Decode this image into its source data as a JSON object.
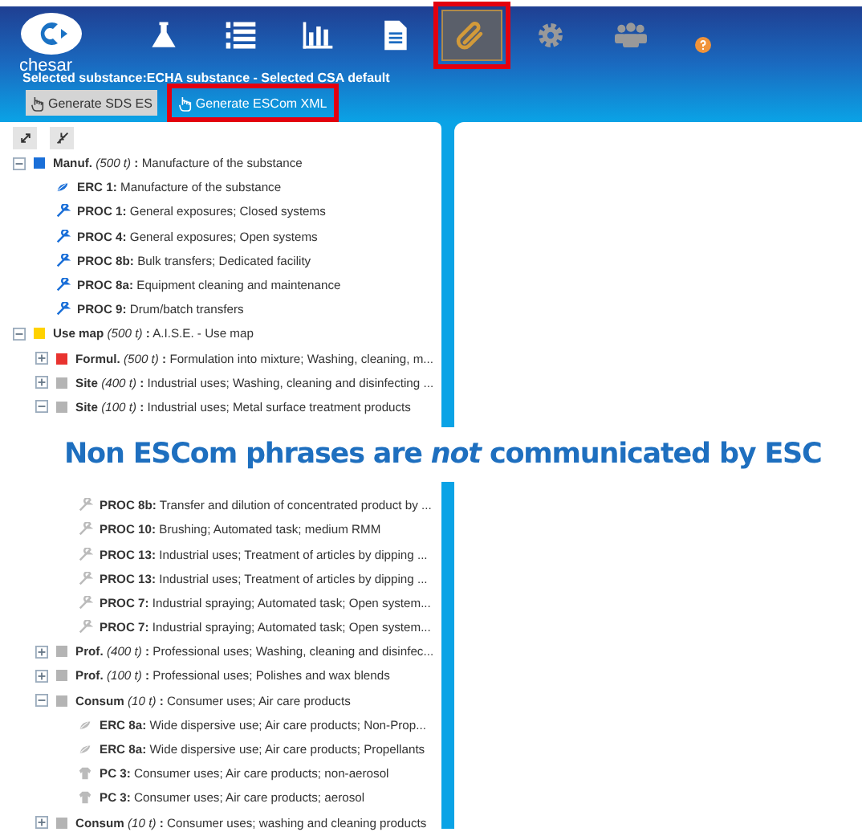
{
  "header": {
    "logo_text": "chesar",
    "toolbar": [
      {
        "kind": "flask",
        "selected": false,
        "highlighted": false
      },
      {
        "kind": "list",
        "selected": false,
        "highlighted": false
      },
      {
        "kind": "chart",
        "selected": false,
        "highlighted": false
      },
      {
        "kind": "document",
        "selected": false,
        "highlighted": false
      },
      {
        "kind": "clip",
        "selected": true,
        "highlighted": true
      },
      {
        "kind": "gear",
        "selected": false,
        "highlighted": false
      },
      {
        "kind": "people",
        "selected": false,
        "highlighted": false
      },
      {
        "kind": "help",
        "selected": false,
        "highlighted": false
      }
    ],
    "context": "Selected substance:ECHA substance - Selected CSA default",
    "buttons": [
      {
        "label": "Generate SDS ES",
        "highlighted": false
      },
      {
        "label": "Generate ESCom XML",
        "highlighted": true
      }
    ]
  },
  "tree": [
    {
      "kind": "group",
      "label": "**Manuf.** *(500 t)* **:** Manufacture of the substance",
      "color": "#1a6fd8",
      "expanded": true,
      "children": [
        {
          "kind": "erc",
          "label": "**ERC 1:** Manufacture of the substance",
          "disabled": false
        },
        {
          "kind": "proc",
          "label": "**PROC 1:** General exposures; Closed systems",
          "disabled": false
        },
        {
          "kind": "proc",
          "label": "**PROC 4:** General exposures; Open systems",
          "disabled": false
        },
        {
          "kind": "proc",
          "label": "**PROC 8b:** Bulk transfers; Dedicated facility",
          "disabled": false
        },
        {
          "kind": "proc",
          "label": "**PROC 8a:** Equipment cleaning and maintenance",
          "disabled": false
        },
        {
          "kind": "proc",
          "label": "**PROC 9:** Drum/batch transfers",
          "disabled": false
        }
      ]
    },
    {
      "kind": "group",
      "label": "**Use map** *(500 t)* **:** A.I.S.E. - Use map",
      "color": "#ffd200",
      "expanded": true,
      "children": [
        {
          "kind": "group",
          "label": "**Formul.** *(500 t)* **:** Formulation into mixture; Washing, cleaning, m...",
          "color": "#e8332f",
          "expanded": false
        },
        {
          "kind": "group",
          "label": "**Site** *(400 t)* **:** Industrial uses; Washing, cleaning and disinfecting ...",
          "color": "#b4b4b4",
          "expanded": false
        },
        {
          "kind": "group",
          "label": "**Site** *(100 t)* **:** Industrial uses; Metal surface treatment products",
          "color": "#b4b4b4",
          "expanded": true,
          "children": [
            {
              "kind": "proc",
              "label": "**PROC 8b:** Transfer and dilution of concentrated product by ...",
              "disabled": true
            },
            {
              "kind": "proc",
              "label": "**PROC 10:** Brushing; Automated task; medium RMM",
              "disabled": true
            },
            {
              "kind": "proc",
              "label": "**PROC 13:** Industrial uses; Treatment of articles by dipping ...",
              "disabled": true
            },
            {
              "kind": "proc",
              "label": "**PROC 13:** Industrial uses; Treatment of articles by dipping ...",
              "disabled": true
            },
            {
              "kind": "proc",
              "label": "**PROC 7:** Industrial spraying; Automated task; Open system...",
              "disabled": true
            },
            {
              "kind": "proc",
              "label": "**PROC 7:** Industrial spraying; Automated task; Open system...",
              "disabled": true
            }
          ]
        },
        {
          "kind": "group",
          "label": "**Prof.** *(400 t)* **:** Professional uses; Washing, cleaning and disinfec...",
          "color": "#b4b4b4",
          "expanded": false
        },
        {
          "kind": "group",
          "label": "**Prof.** *(100 t)* **:** Professional uses; Polishes and wax blends",
          "color": "#b4b4b4",
          "expanded": false
        },
        {
          "kind": "group",
          "label": "**Consum** *(10 t)* **:** Consumer uses; Air care products",
          "color": "#b4b4b4",
          "expanded": true,
          "children": [
            {
              "kind": "erc",
              "label": "**ERC 8a:** Wide dispersive use; Air care products; Non-Prop...",
              "disabled": true
            },
            {
              "kind": "erc",
              "label": "**ERC 8a:** Wide dispersive use; Air care products; Propellants",
              "disabled": true
            },
            {
              "kind": "pc",
              "label": "**PC 3:** Consumer uses; Air care products; non-aerosol",
              "disabled": true
            },
            {
              "kind": "pc",
              "label": "**PC 3:** Consumer uses; Air care products; aerosol",
              "disabled": true
            }
          ]
        },
        {
          "kind": "group",
          "label": "**Consum** *(10 t)* **:** Consumer uses; washing and cleaning products",
          "color": "#b4b4b4",
          "expanded": false
        }
      ]
    }
  ],
  "caption": "Non ESCom phrases are *not* communicated by ESC"
}
